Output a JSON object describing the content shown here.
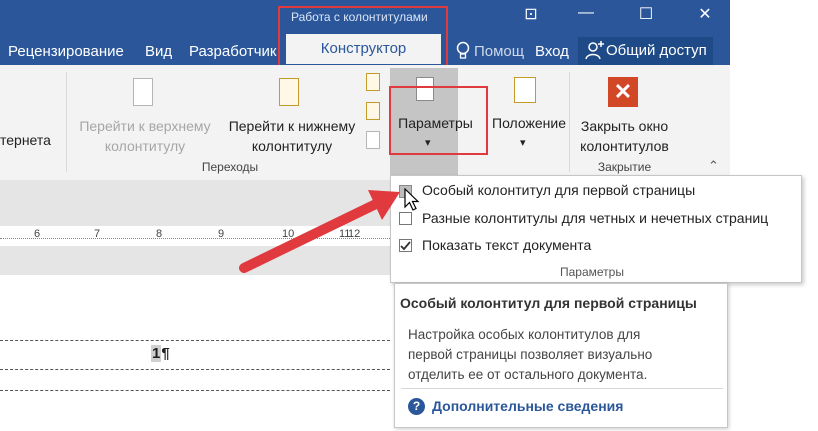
{
  "context_tabs": {
    "group_label": "Работа с колонтитулами",
    "active_tab": "Конструктор"
  },
  "tabs": [
    "Рецензирование",
    "Вид",
    "Разработчик"
  ],
  "tell_me": "Помощ",
  "signin": "Вход",
  "share": "Общий доступ",
  "window_controls": {
    "ribbon_options": "⊡",
    "minimize": "—",
    "maximize": "☐",
    "close": "✕"
  },
  "ribbon": {
    "partial_label": "тернета",
    "go_header_line1": "Перейти к верхнему",
    "go_header_line2": "колонтитулу",
    "go_footer_line1": "Перейти к нижнему",
    "go_footer_line2": "колонтитулу",
    "navigation_group": "Переходы",
    "params_label": "Параметры",
    "position_label": "Положение",
    "close_line1": "Закрыть окно",
    "close_line2": "колонтитулов",
    "close_group": "Закрытие",
    "dropdown_caret": "▾",
    "collapse_caret": "⌃",
    "close_icon": "✕"
  },
  "ruler": {
    "ticks": [
      "6",
      "7",
      "8",
      "9",
      "10",
      "11",
      "12"
    ]
  },
  "document": {
    "page_number": "1",
    "pilcrow": "¶"
  },
  "params_dropdown": {
    "options": [
      {
        "label": "Особый колонтитул для первой страницы",
        "checked": false
      },
      {
        "label": "Разные колонтитулы для четных и нечетных страниц",
        "checked": false
      },
      {
        "label": "Показать текст документа",
        "checked": true
      }
    ],
    "group_label": "Параметры"
  },
  "tooltip": {
    "title": "Особый колонтитул для первой страницы",
    "body_line1": "Настройка особых колонтитулов для",
    "body_line2": "первой страницы позволяет визуально",
    "body_line3": "отделить ее от остального документа.",
    "help_icon": "?",
    "link": "Дополнительные сведения"
  },
  "colors": {
    "ribbon_blue": "#2b579a",
    "annotation_red": "#e03a3e",
    "close_red": "#d24726"
  },
  "icons": [
    "light-bulb-icon",
    "person-add-icon",
    "header-go-icon",
    "footer-go-icon",
    "params-icon",
    "position-icon",
    "close-x-icon",
    "checkmark-icon",
    "help-icon",
    "cursor-icon",
    "arrow-annotation"
  ]
}
